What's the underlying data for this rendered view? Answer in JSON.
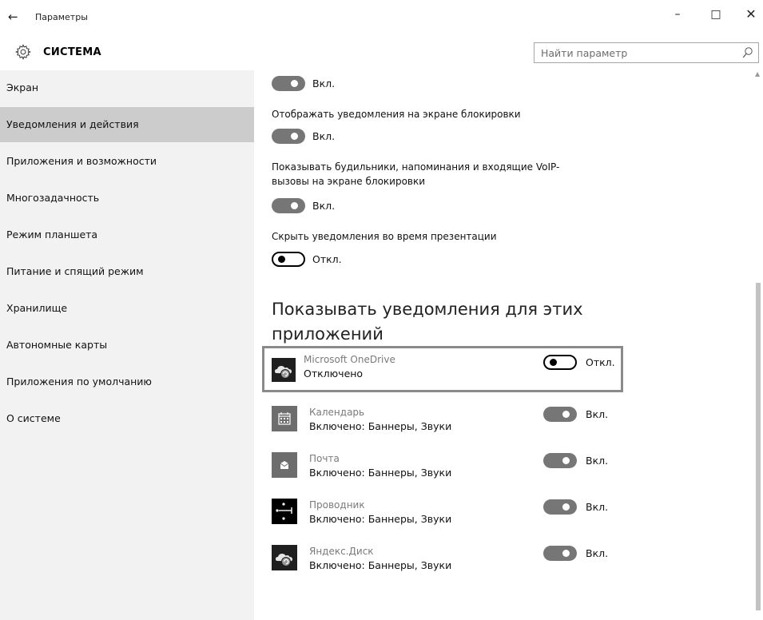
{
  "window": {
    "title": "Параметры",
    "back_glyph": "←",
    "minimize_glyph": "–",
    "maximize_glyph": "□",
    "close_glyph": "✕"
  },
  "header": {
    "title": "СИСТЕМА",
    "search_placeholder": "Найти параметр"
  },
  "sidebar": {
    "items": [
      {
        "label": "Экран"
      },
      {
        "label": "Уведомления и действия",
        "active": true
      },
      {
        "label": "Приложения и возможности"
      },
      {
        "label": "Многозадачность"
      },
      {
        "label": "Режим планшета"
      },
      {
        "label": "Питание и спящий режим"
      },
      {
        "label": "Хранилище"
      },
      {
        "label": "Автономные карты"
      },
      {
        "label": "Приложения по умолчанию"
      },
      {
        "label": "О системе"
      }
    ]
  },
  "settings": [
    {
      "label": "",
      "state": "Вкл.",
      "on": true
    },
    {
      "label": "Отображать уведомления на экране блокировки",
      "state": "Вкл.",
      "on": true
    },
    {
      "label": "Показывать будильники, напоминания и входящие VoIP-",
      "label2": "вызовы на экране блокировки",
      "state": "Вкл.",
      "on": true
    },
    {
      "label": "Скрыть уведомления во время презентации",
      "state": "Откл.",
      "on": false
    }
  ],
  "apps_section": {
    "title_line1": "Показывать уведомления для этих",
    "title_line2": "приложений"
  },
  "apps": [
    {
      "name": "Microsoft OneDrive",
      "status": "Отключено",
      "state": "Откл.",
      "on": false,
      "icon": "onedrive-cloud-icon"
    },
    {
      "name": "Календарь",
      "status": "Включено: Баннеры, Звуки",
      "state": "Вкл.",
      "on": true,
      "icon": "calendar-icon"
    },
    {
      "name": "Почта",
      "status": "Включено: Баннеры, Звуки",
      "state": "Вкл.",
      "on": true,
      "icon": "mail-icon"
    },
    {
      "name": "Проводник",
      "status": "Включено: Баннеры, Звуки",
      "state": "Вкл.",
      "on": true,
      "icon": "explorer-icon"
    },
    {
      "name": "Яндекс.Диск",
      "status": "Включено: Баннеры, Звуки",
      "state": "Вкл.",
      "on": true,
      "icon": "yandex-disk-icon"
    }
  ],
  "colors": {
    "sidebar_bg": "#f2f2f2",
    "active_item_bg": "#cccccc",
    "toggle_on": "#767676",
    "highlight_border": "#8a8a8a"
  }
}
